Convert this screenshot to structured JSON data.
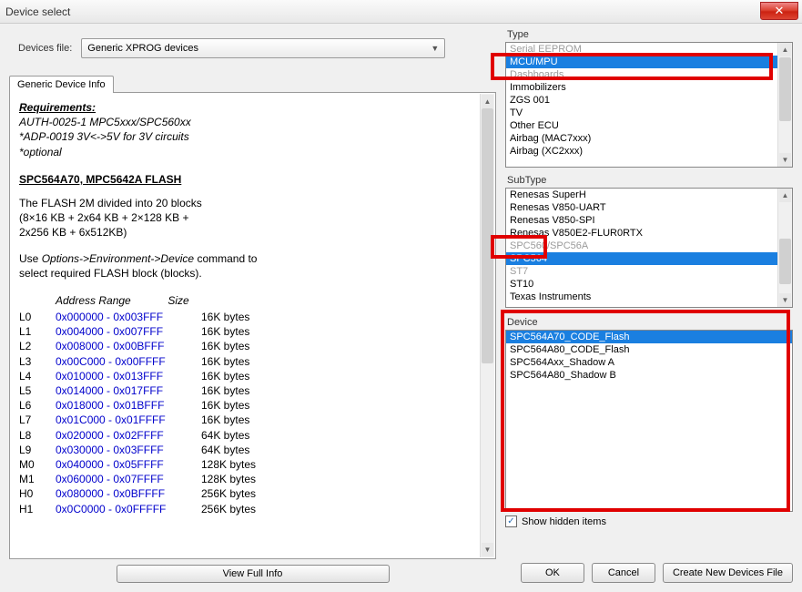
{
  "window": {
    "title": "Device select"
  },
  "devices_file": {
    "label": "Devices file:",
    "value": "Generic XPROG devices"
  },
  "tab_label": "Generic Device Info",
  "info": {
    "req_h": "Requirements:",
    "req1": "AUTH-0025-1 MPC5xxx/SPC560xx",
    "req2": "*ADP-0019 3V<->5V for 3V circuits",
    "req3": "*optional",
    "sec_h": "SPC564A70, MPC5642A FLASH",
    "flash1": "The FLASH 2M divided into 20 blocks",
    "flash2": "(8×16 KB + 2x64 KB +  2×128 KB +",
    "flash3": "2x256 KB + 6x512KB)",
    "hint1a": "Use ",
    "hint1b": "Options->Environment->Device",
    "hint1c": " command to",
    "hint2": "select required FLASH block (blocks).",
    "col_addr": "Address Range",
    "col_size": "Size",
    "rows": [
      {
        "lbl": "L0",
        "addr": "0x000000 - 0x003FFF",
        "size": "16K bytes"
      },
      {
        "lbl": "L1",
        "addr": "0x004000 - 0x007FFF",
        "size": "16K bytes"
      },
      {
        "lbl": "L2",
        "addr": "0x008000 - 0x00BFFF",
        "size": "16K bytes"
      },
      {
        "lbl": "L3",
        "addr": "0x00C000 - 0x00FFFF",
        "size": "16K bytes"
      },
      {
        "lbl": "L4",
        "addr": "0x010000 - 0x013FFF",
        "size": "16K bytes"
      },
      {
        "lbl": "L5",
        "addr": "0x014000 - 0x017FFF",
        "size": "16K bytes"
      },
      {
        "lbl": "L6",
        "addr": "0x018000 - 0x01BFFF",
        "size": "16K bytes"
      },
      {
        "lbl": "L7",
        "addr": "0x01C000 - 0x01FFFF",
        "size": "16K bytes"
      },
      {
        "lbl": "L8",
        "addr": "0x020000 - 0x02FFFF",
        "size": "64K bytes"
      },
      {
        "lbl": "L9",
        "addr": "0x030000 - 0x03FFFF",
        "size": "64K bytes"
      },
      {
        "lbl": "M0",
        "addr": "0x040000 - 0x05FFFF",
        "size": "128K bytes"
      },
      {
        "lbl": "M1",
        "addr": "0x060000 - 0x07FFFF",
        "size": "128K bytes"
      },
      {
        "lbl": "H0",
        "addr": "0x080000 - 0x0BFFFF",
        "size": "256K bytes"
      },
      {
        "lbl": "H1",
        "addr": "0x0C0000 - 0x0FFFFF",
        "size": "256K bytes"
      }
    ]
  },
  "view_full_label": "View Full Info",
  "type": {
    "label": "Type",
    "items": [
      {
        "t": "Serial EEPROM",
        "sel": false,
        "muted": true
      },
      {
        "t": "MCU/MPU",
        "sel": true
      },
      {
        "t": "Dashboards",
        "sel": false,
        "muted": true
      },
      {
        "t": "Immobilizers",
        "sel": false
      },
      {
        "t": "ZGS 001",
        "sel": false
      },
      {
        "t": "TV",
        "sel": false
      },
      {
        "t": "Other ECU",
        "sel": false
      },
      {
        "t": "Airbag (MAC7xxx)",
        "sel": false
      },
      {
        "t": "Airbag (XC2xxx)",
        "sel": false
      }
    ]
  },
  "subtype": {
    "label": "SubType",
    "items": [
      {
        "t": "Renesas SuperH",
        "sel": false
      },
      {
        "t": "Renesas V850-UART",
        "sel": false
      },
      {
        "t": "Renesas V850-SPI",
        "sel": false
      },
      {
        "t": "Renesas V850E2-FLUR0RTX",
        "sel": false
      },
      {
        "t": "SPC560/SPC56A",
        "sel": false,
        "muted": true
      },
      {
        "t": "SPC564",
        "sel": true
      },
      {
        "t": "ST7",
        "sel": false,
        "muted": true
      },
      {
        "t": "ST10",
        "sel": false
      },
      {
        "t": "Texas Instruments",
        "sel": false
      }
    ]
  },
  "device": {
    "label": "Device",
    "items": [
      {
        "t": "SPC564A70_CODE_Flash",
        "sel": true
      },
      {
        "t": "SPC564A80_CODE_Flash",
        "sel": false
      },
      {
        "t": "SPC564Axx_Shadow A",
        "sel": false
      },
      {
        "t": "SPC564A80_Shadow B",
        "sel": false
      }
    ]
  },
  "show_hidden": {
    "label": "Show hidden items",
    "checked": true
  },
  "buttons": {
    "ok": "OK",
    "cancel": "Cancel",
    "create": "Create New Devices File"
  }
}
